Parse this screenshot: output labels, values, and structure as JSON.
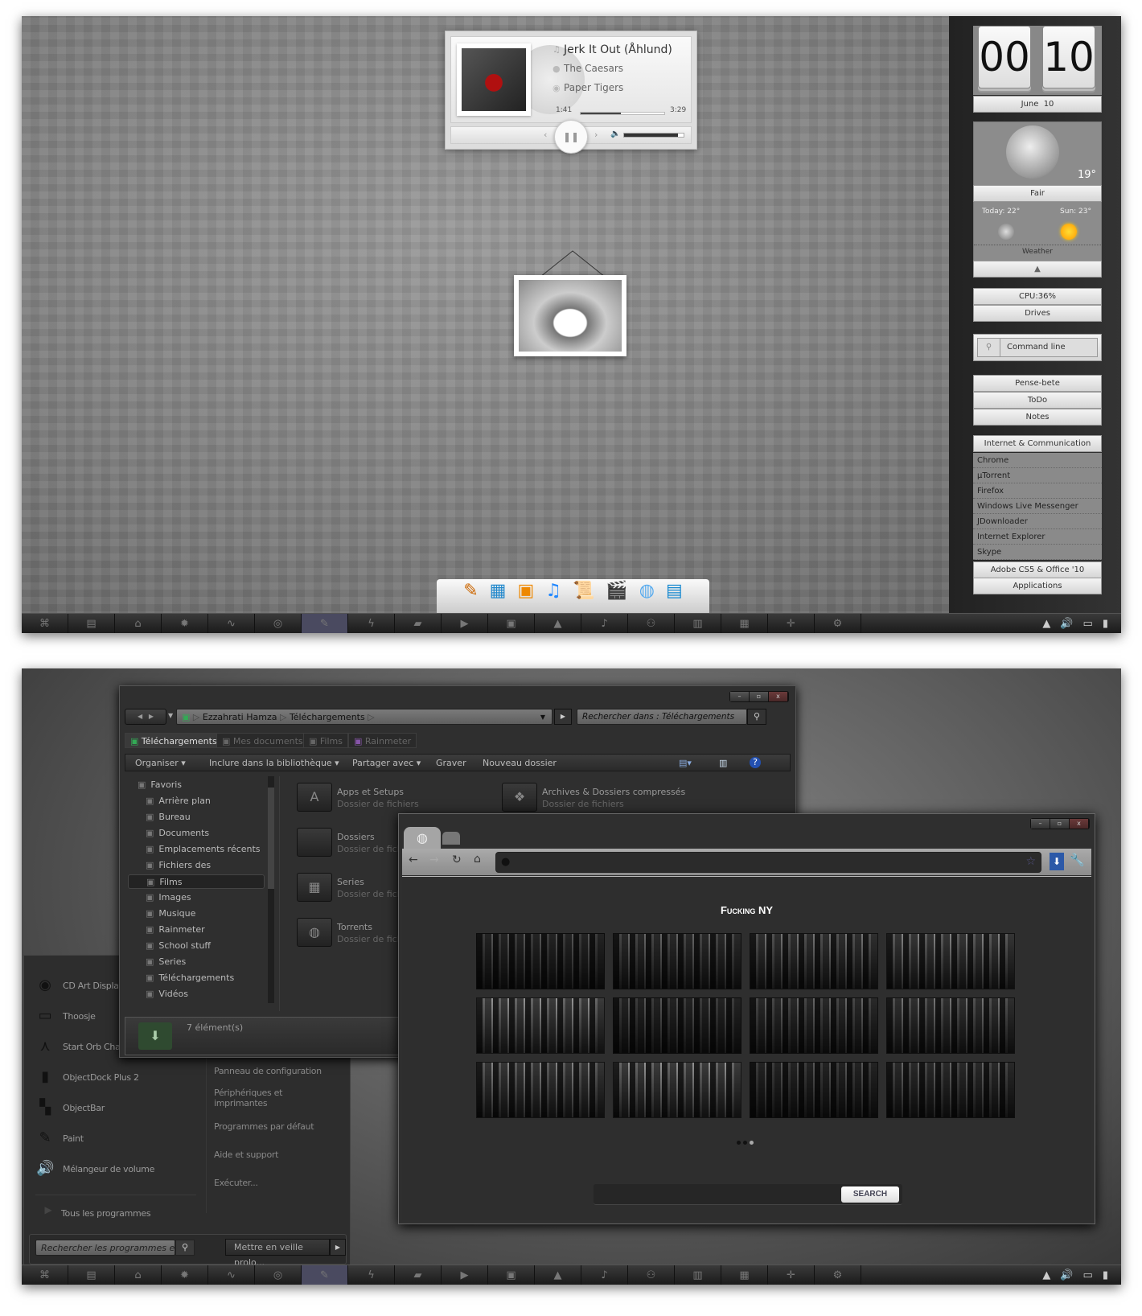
{
  "top_desktop": {
    "music_player": {
      "title": "Jerk It Out (Åhlund)",
      "artist": "The Caesars",
      "album": "Paper Tigers",
      "elapsed": "1:41",
      "duration": "3:29",
      "progress_fraction": 0.48,
      "volume_fraction": 0.9,
      "icons": [
        "note-icon",
        "artist-icon",
        "album-icon",
        "previous-icon",
        "pause-icon",
        "next-icon",
        "volume-icon"
      ]
    },
    "dock_icons": [
      "app-store-icon",
      "movie-icon",
      "photo-icon",
      "itunes-icon",
      "script-icon",
      "clapper-icon",
      "network-globe-icon",
      "system-monitor-icon"
    ],
    "clock": {
      "hours": "00",
      "minutes": "10",
      "date": "June  10"
    },
    "weather": {
      "temp": "19°",
      "condition": "Fair",
      "today": "Today: 22°",
      "tomorrow": "Sun: 23°",
      "label": "Weather"
    },
    "system": {
      "cpu": "CPU:36%",
      "drives": "Drives"
    },
    "command_line": "Command line",
    "notes_buttons": [
      "Pense-bete",
      "ToDo",
      "Notes"
    ],
    "launcher": {
      "header": "Internet & Communication",
      "items": [
        "Chrome",
        "µTorrent",
        "Firefox",
        "Windows Live Messenger",
        "JDownloader",
        "Internet Explorer",
        "Skype"
      ],
      "groups": [
        "Adobe CS5 & Office '10",
        "Applications"
      ]
    }
  },
  "taskbar": {
    "icons": [
      "start-orb-icon",
      "explorer-icon",
      "lighthouse-icon",
      "gear-icon",
      "pulse-icon",
      "chrome-icon",
      "feather-icon",
      "bolt-icon",
      "clapper-icon",
      "play-icon",
      "drive-icon",
      "flask-icon",
      "music-icon",
      "people-icon",
      "docs-icon",
      "terminal-icon",
      "plus-icon",
      "settings-icon"
    ],
    "glyphs": [
      "⌘",
      "▤",
      "⌂",
      "✹",
      "∿",
      "◎",
      "✎",
      "ϟ",
      "▰",
      "▶",
      "▣",
      "▲",
      "♪",
      "⚇",
      "▥",
      "▦",
      "✛",
      "⚙"
    ],
    "tray": [
      "▲",
      "🔊",
      "▭",
      "▮"
    ]
  },
  "explorer": {
    "breadcrumb": [
      "Ezzahrati Hamza",
      "Téléchargements"
    ],
    "search_placeholder": "Rechercher dans : Téléchargements",
    "tabs": [
      "Téléchargements",
      "Mes documents",
      "Films",
      "Rainmeter"
    ],
    "toolbar": [
      "Organiser ▾",
      "Inclure dans la bibliothèque ▾",
      "Partager avec ▾",
      "Graver",
      "Nouveau dossier"
    ],
    "nav_header": "Favoris",
    "nav_items": [
      "Arrière plan",
      "Bureau",
      "Documents",
      "Emplacements récents",
      "Fichiers des Programmes",
      "Films",
      "Images",
      "Musique",
      "Rainmeter",
      "School stuff",
      "Series",
      "Téléchargements",
      "Vidéos"
    ],
    "selected_nav": "Films",
    "files": [
      {
        "name": "Apps et Setups",
        "type": "Dossier de fichiers"
      },
      {
        "name": "Archives & Dossiers compressés",
        "type": "Dossier de fichiers"
      },
      {
        "name": "Dossiers",
        "type": "Dossier de fich"
      },
      {
        "name": "Series",
        "type": "Dossier de fich"
      },
      {
        "name": "Torrents",
        "type": "Dossier de fich"
      }
    ],
    "status": "7 élément(s)"
  },
  "start_menu": {
    "programs": [
      "CD Art Display",
      "Thoosje",
      "Start Orb Cha",
      "ObjectDock Plus 2",
      "ObjectBar",
      "Paint",
      "Mélangeur de volume"
    ],
    "all_programs": "Tous les programmes",
    "right_items": [
      "Panneau de configuration",
      "Périphériques et imprimantes",
      "Programmes par défaut",
      "Aide et support",
      "Exécuter..."
    ],
    "search_placeholder": "Rechercher les programmes et fi...",
    "shutdown": "Mettre en veille prolo..."
  },
  "browser": {
    "page_title": "Fucking NY",
    "search_button": "SEARCH",
    "gallery_pages": 3,
    "active_page": 3
  }
}
